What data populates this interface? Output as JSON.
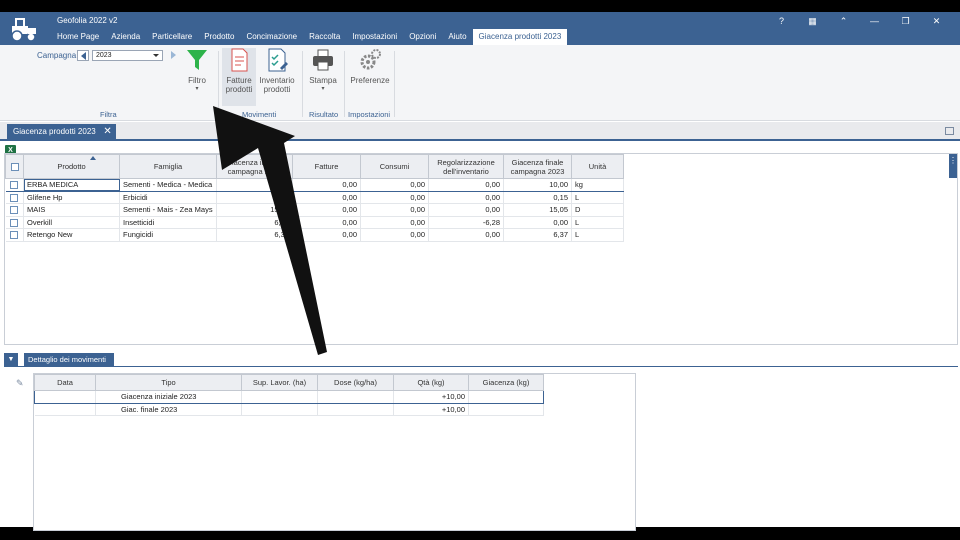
{
  "app": {
    "title": "Geofolia 2022 v2"
  },
  "menu": [
    "Home Page",
    "Azienda",
    "Particellare",
    "Prodotto",
    "Concimazione",
    "Raccolta",
    "Impostazioni",
    "Opzioni",
    "Aiuto",
    "Giacenza prodotti 2023"
  ],
  "window_controls": {
    "help": "?",
    "calc": "▦",
    "collapse": "⌃",
    "minimize": "—",
    "restore": "❐",
    "close": "✕"
  },
  "ribbon": {
    "campagna_label": "Campagna",
    "campagna_value": "2023",
    "buttons": {
      "filtro": "Filtro",
      "fatture": "Fatture\nprodotti",
      "inventario": "Inventario\nprodotti",
      "stampa": "Stampa",
      "preferenze": "Preferenze"
    },
    "groups": {
      "filtra": "Filtra",
      "movimenti": "Movimenti",
      "risultato": "Risultato",
      "impostazioni": "Impostazioni"
    }
  },
  "doc_tab": {
    "label": "Giacenza prodotti 2023"
  },
  "grid": {
    "headers": [
      "Prodotto",
      "Famiglia",
      "Giacenza iniziale campagna 2023",
      "Fatture",
      "Consumi",
      "Regolarizzazione dell'inventario",
      "Giacenza finale campagna 2023",
      "Unità"
    ],
    "rows": [
      {
        "prodotto": "ERBA MEDICA",
        "famiglia": "Sementi - Medica - Medica",
        "iniziale": "10,00",
        "fatture": "0,00",
        "consumi": "0,00",
        "regol": "0,00",
        "finale": "10,00",
        "unita": "kg"
      },
      {
        "prodotto": "Glifene Hp",
        "famiglia": "Erbicidi",
        "iniziale": "0,15",
        "fatture": "0,00",
        "consumi": "0,00",
        "regol": "0,00",
        "finale": "0,15",
        "unita": "L"
      },
      {
        "prodotto": "MAIS",
        "famiglia": "Sementi - Mais - Zea Mays",
        "iniziale": "15,05",
        "fatture": "0,00",
        "consumi": "0,00",
        "regol": "0,00",
        "finale": "15,05",
        "unita": "D"
      },
      {
        "prodotto": "Overkill",
        "famiglia": "Insetticidi",
        "iniziale": "6,28",
        "fatture": "0,00",
        "consumi": "0,00",
        "regol": "-6,28",
        "finale": "0,00",
        "unita": "L"
      },
      {
        "prodotto": "Retengo New",
        "famiglia": "Fungicidi",
        "iniziale": "6,37",
        "fatture": "0,00",
        "consumi": "0,00",
        "regol": "0,00",
        "finale": "6,37",
        "unita": "L"
      }
    ]
  },
  "detail": {
    "tab_label": "Dettaglio dei movimenti",
    "headers": [
      "Data",
      "Tipo",
      "Sup. Lavor. (ha)",
      "Dose (kg/ha)",
      "Qtà (kg)",
      "Giacenza (kg)"
    ],
    "rows": [
      {
        "data": "",
        "tipo": "Giacenza iniziale 2023",
        "sup": "",
        "dose": "",
        "qta": "+10,00",
        "giac": ""
      },
      {
        "data": "",
        "tipo": "Giac. finale 2023",
        "sup": "",
        "dose": "",
        "qta": "+10,00",
        "giac": ""
      }
    ]
  },
  "colors": {
    "primary": "#3c6292",
    "filter_green": "#2db34a",
    "excel_green": "#1f7244"
  }
}
